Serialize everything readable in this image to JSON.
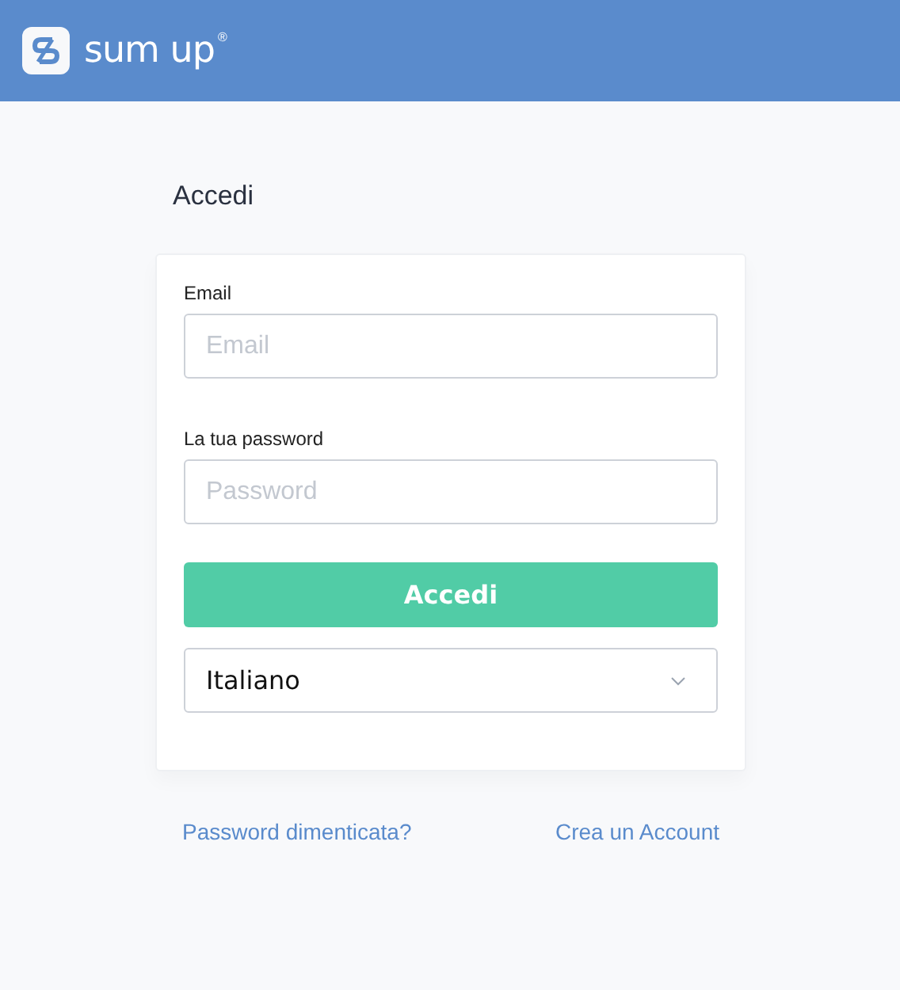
{
  "header": {
    "logo_text": "sum up",
    "logo_mark": "®"
  },
  "title": "Accedi",
  "form": {
    "fields": [
      {
        "label": "Email",
        "placeholder": "Email"
      },
      {
        "label": "La tua password",
        "placeholder": "Password"
      }
    ],
    "submit": "Accedi",
    "language": "Italiano"
  },
  "links": [
    "Password dimenticata?",
    "Crea un Account"
  ]
}
